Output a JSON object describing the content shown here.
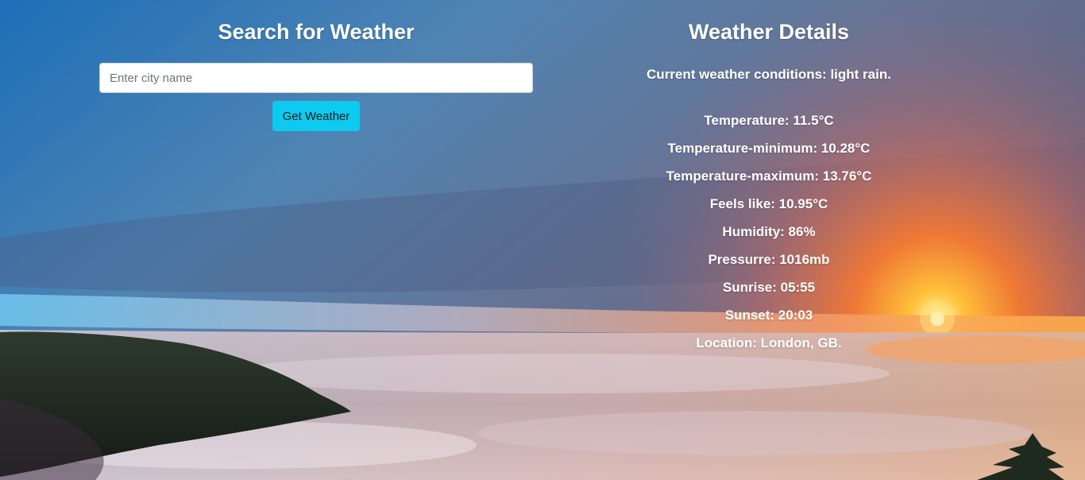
{
  "search": {
    "title": "Search for Weather",
    "input_placeholder": "Enter city name",
    "input_value": "",
    "button_label": "Get Weather"
  },
  "details": {
    "title": "Weather Details",
    "condition": "Current weather conditions: light rain.",
    "rows": [
      "Temperature: 11.5°C",
      "Temperature-minimum: 10.28°C",
      "Temperature-maximum: 13.76°C",
      "Feels like: 10.95°C",
      "Humidity: 86%",
      "Pressurre: 1016mb",
      "Sunrise: 05:55",
      "Sunset: 20:03",
      "Location: London, GB."
    ]
  },
  "colors": {
    "button": "#0dcaf0",
    "text": "#ffffff"
  }
}
